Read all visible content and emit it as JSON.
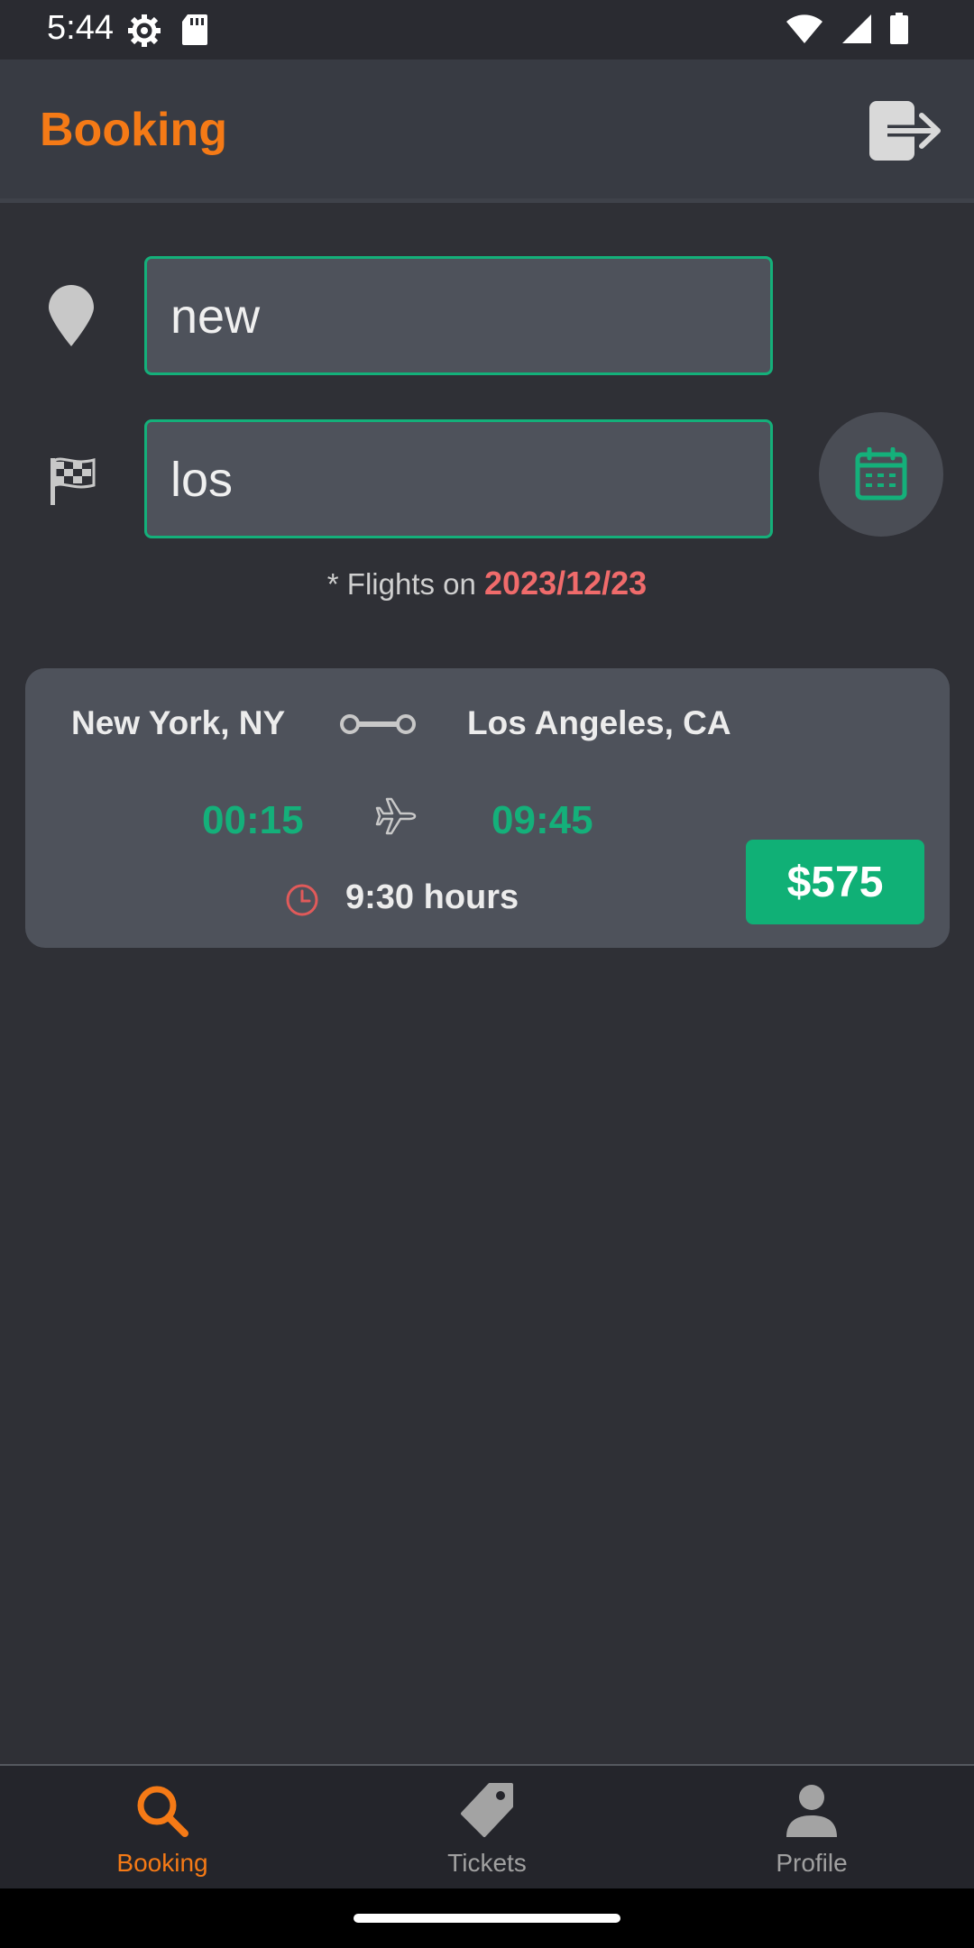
{
  "status_bar": {
    "time": "5:44",
    "icons": [
      "settings-gear-icon",
      "sd-card-icon",
      "wifi-icon",
      "cellular-signal-icon",
      "battery-icon"
    ]
  },
  "app_bar": {
    "title": "Booking",
    "logout_icon": "logout-icon"
  },
  "search": {
    "origin": {
      "icon": "location-pin-icon",
      "value": "new"
    },
    "destination": {
      "icon": "checkered-flag-icon",
      "value": "los"
    },
    "calendar_icon": "calendar-icon"
  },
  "flights_note": {
    "prefix": "* Flights on ",
    "date": "2023/12/23"
  },
  "flight_card": {
    "from_city": "New York, NY",
    "to_city": "Los Angeles, CA",
    "departure_time": "00:15",
    "arrival_time": "09:45",
    "duration": "9:30 hours",
    "price": "$575",
    "route_icon": "route-connector-icon",
    "plane_icon": "airplane-icon",
    "clock_icon": "clock-icon"
  },
  "bottom_nav": {
    "items": [
      {
        "label": "Booking",
        "icon": "search-icon",
        "active": true
      },
      {
        "label": "Tickets",
        "icon": "ticket-tag-icon",
        "active": false
      },
      {
        "label": "Profile",
        "icon": "person-icon",
        "active": false
      }
    ]
  },
  "colors": {
    "accent_orange": "#f57a16",
    "accent_green": "#14b07a",
    "date_red": "#f06b6b",
    "background": "#2f3036",
    "card": "#4e525b"
  }
}
